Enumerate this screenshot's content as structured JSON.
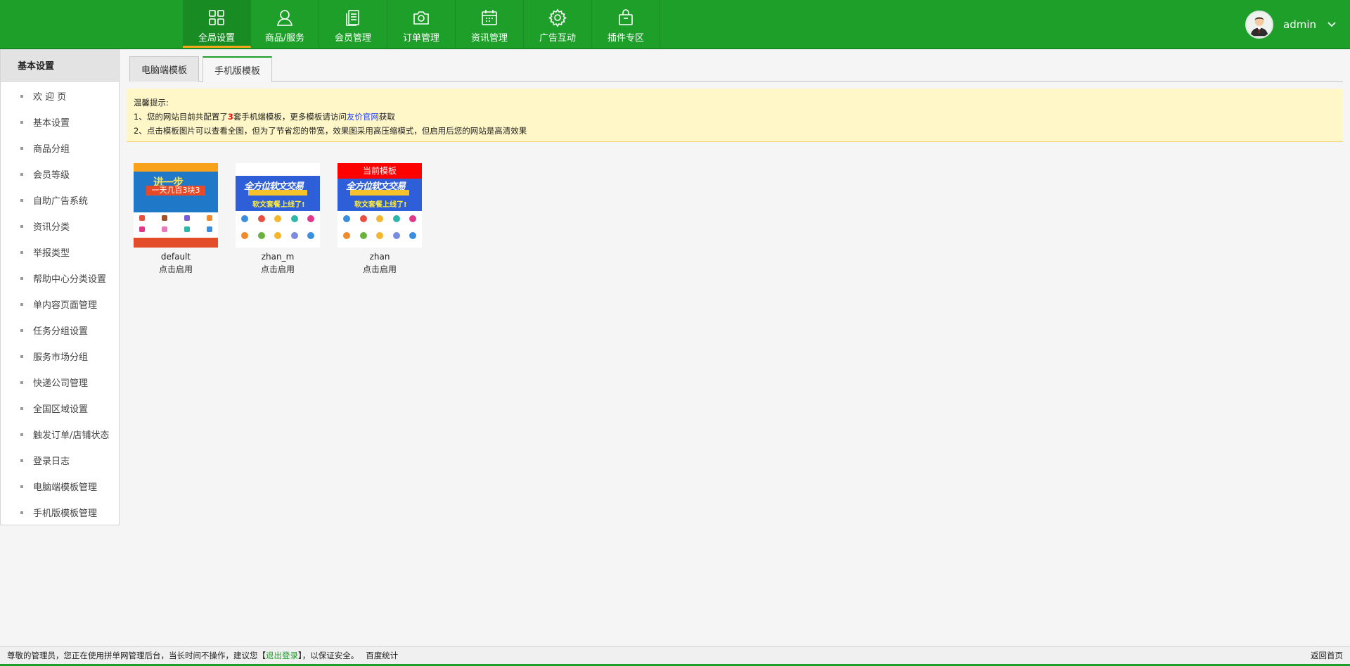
{
  "nav": {
    "items": [
      {
        "label": "全局设置",
        "icon": "grid-icon"
      },
      {
        "label": "商品/服务",
        "icon": "user-icon"
      },
      {
        "label": "会员管理",
        "icon": "document-icon"
      },
      {
        "label": "订单管理",
        "icon": "camera-icon"
      },
      {
        "label": "资讯管理",
        "icon": "calendar-icon"
      },
      {
        "label": "广告互动",
        "icon": "gear-icon"
      },
      {
        "label": "插件专区",
        "icon": "bag-icon"
      }
    ],
    "active_index": 0
  },
  "user": {
    "name": "admin",
    "avatar_icon": "avatar-icon",
    "menu_icon": "chevron-down-icon"
  },
  "sidebar": {
    "title": "基本设置",
    "items": [
      {
        "label": "欢 迎 页"
      },
      {
        "label": "基本设置"
      },
      {
        "label": "商品分组"
      },
      {
        "label": "会员等级"
      },
      {
        "label": "自助广告系统"
      },
      {
        "label": "资讯分类"
      },
      {
        "label": "举报类型"
      },
      {
        "label": "帮助中心分类设置"
      },
      {
        "label": "单内容页面管理"
      },
      {
        "label": "任务分组设置"
      },
      {
        "label": "服务市场分组"
      },
      {
        "label": "快递公司管理"
      },
      {
        "label": "全国区域设置"
      },
      {
        "label": "触发订单/店铺状态"
      },
      {
        "label": "登录日志"
      },
      {
        "label": "电脑端模板管理"
      },
      {
        "label": "手机版模板管理"
      }
    ]
  },
  "tabs": [
    {
      "label": "电脑端模板",
      "active": false
    },
    {
      "label": "手机版模板",
      "active": true
    }
  ],
  "notice": {
    "title": "温馨提示:",
    "line1_prefix": "1、您的网站目前共配置了",
    "line1_count": "3",
    "line1_mid": "套手机端模板，更多模板请访问",
    "line1_link": "友价官网",
    "line1_suffix": "获取",
    "line2": "2、点击模板图片可以查看全图，但为了节省您的带宽，效果图采用高压缩模式，但启用后您的网站是高清效果"
  },
  "templates": [
    {
      "name": "default",
      "action": "点击启用",
      "banner_text": "进一步",
      "banner_sub": "一天几百3块3",
      "current": false
    },
    {
      "name": "zhan_m",
      "action": "点击启用",
      "banner_text": "全方位软文交易",
      "banner_sub": "软文套餐上线了!",
      "current": false
    },
    {
      "name": "zhan",
      "action": "点击启用",
      "banner_text": "全方位软文交易",
      "banner_sub": "软文套餐上线了!",
      "current": true,
      "current_label": "当前模板"
    }
  ],
  "footer": {
    "text_prefix": "尊敬的管理员，您正在使用拼单网管理后台，当长时间不操作，建议您【",
    "logout": "退出登录",
    "text_suffix": "】，以保证安全。",
    "stats": "百度统计",
    "home": "返回首页"
  },
  "colors": {
    "brand": "#1e9f2a",
    "accent": "#f3a71c",
    "notice_bg": "#fff7c7",
    "current_badge": "#ff0000"
  }
}
